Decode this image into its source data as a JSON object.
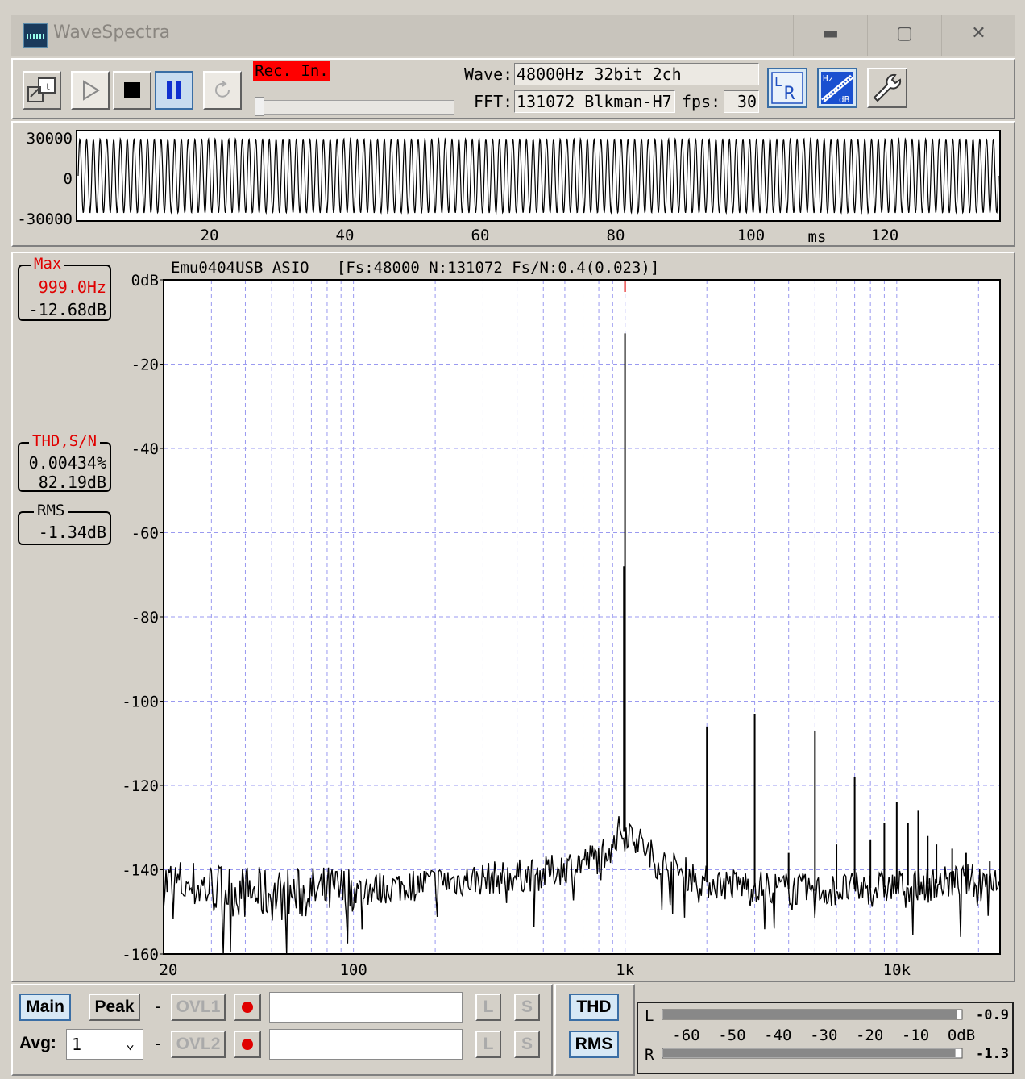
{
  "window": {
    "title": "WaveSpectra",
    "minimize": "▬",
    "maximize": "▢",
    "close": "✕"
  },
  "toolbar": {
    "rec_in_label": "Rec. In.",
    "wave_label": "Wave:",
    "wave_value": "48000Hz 32bit 2ch",
    "fft_label": "FFT:",
    "fft_value": "131072 Blkman-H7",
    "fps_label": "fps:",
    "fps_value": "30"
  },
  "wave": {
    "y_ticks": [
      "30000",
      "0",
      "-30000"
    ],
    "x_ticks": [
      "20",
      "40",
      "60",
      "80",
      "100",
      "120"
    ],
    "x_unit": "ms"
  },
  "spectrum": {
    "header": "Emu0404USB ASIO   [Fs:48000 N:131072 Fs/N:0.4(0.023)]",
    "max_box": {
      "caption": "Max",
      "freq": "999.0Hz",
      "level": "-12.68dB"
    },
    "thd_box": {
      "caption": "THD,S/N",
      "thd": "0.00434%",
      "sn": "82.19dB"
    },
    "rms_box": {
      "caption": "RMS",
      "value": "-1.34dB"
    },
    "y_ticks": [
      "0dB",
      "-20",
      "-40",
      "-60",
      "-80",
      "-100",
      "-120",
      "-140",
      "-160"
    ],
    "x_ticks": [
      "20",
      "100",
      "1k",
      "10k"
    ]
  },
  "chart_data": {
    "type": "line",
    "x_scale": "log",
    "xlim": [
      20,
      24000
    ],
    "ylim": [
      -160,
      0
    ],
    "grid": true,
    "y_ticks": [
      "0dB",
      "-20",
      "-40",
      "-60",
      "-80",
      "-100",
      "-120",
      "-140",
      "-160"
    ],
    "x_ticks": [
      "20",
      "100",
      "1k",
      "10k"
    ],
    "fundamental": {
      "freq_hz": 999.0,
      "level_db": -12.68
    },
    "peaks": [
      {
        "freq_hz": 999,
        "level_db": -12.7
      },
      {
        "freq_hz": 990,
        "level_db": -68
      },
      {
        "freq_hz": 2000,
        "level_db": -106
      },
      {
        "freq_hz": 3000,
        "level_db": -103
      },
      {
        "freq_hz": 4000,
        "level_db": -136
      },
      {
        "freq_hz": 5000,
        "level_db": -107
      },
      {
        "freq_hz": 6000,
        "level_db": -134
      },
      {
        "freq_hz": 7000,
        "level_db": -118
      },
      {
        "freq_hz": 8000,
        "level_db": -133
      },
      {
        "freq_hz": 9000,
        "level_db": -129
      },
      {
        "freq_hz": 10000,
        "level_db": -124
      },
      {
        "freq_hz": 11000,
        "level_db": -129
      },
      {
        "freq_hz": 12000,
        "level_db": -126
      },
      {
        "freq_hz": 13000,
        "level_db": -132
      },
      {
        "freq_hz": 14000,
        "level_db": -134
      },
      {
        "freq_hz": 16000,
        "level_db": -135
      },
      {
        "freq_hz": 18000,
        "level_db": -136
      },
      {
        "freq_hz": 22000,
        "level_db": -138
      }
    ],
    "noise_floor": [
      {
        "freq_hz": 20,
        "level_db": -143
      },
      {
        "freq_hz": 50,
        "level_db": -146
      },
      {
        "freq_hz": 100,
        "level_db": -145
      },
      {
        "freq_hz": 200,
        "level_db": -143
      },
      {
        "freq_hz": 500,
        "level_db": -141
      },
      {
        "freq_hz": 800,
        "level_db": -137
      },
      {
        "freq_hz": 950,
        "level_db": -131
      },
      {
        "freq_hz": 1050,
        "level_db": -131
      },
      {
        "freq_hz": 1300,
        "level_db": -138
      },
      {
        "freq_hz": 2000,
        "level_db": -143
      },
      {
        "freq_hz": 5000,
        "level_db": -145
      },
      {
        "freq_hz": 10000,
        "level_db": -144
      },
      {
        "freq_hz": 24000,
        "level_db": -142
      }
    ]
  },
  "bottom": {
    "main_label": "Main",
    "peak_label": "Peak",
    "ovl1_label": "OVL1",
    "ovl2_label": "OVL2",
    "avg_label": "Avg:",
    "avg_value": "1",
    "dash": "-",
    "l_label": "L",
    "s_label": "S",
    "thd_label": "THD",
    "rms_label": "RMS"
  },
  "meter": {
    "l_label": "L",
    "r_label": "R",
    "l_value": "-0.9",
    "r_value": "-1.3",
    "l_level_db": -0.9,
    "r_level_db": -1.3,
    "scale": [
      "-60",
      "-50",
      "-40",
      "-30",
      "-20",
      "-10",
      "0dB"
    ]
  }
}
